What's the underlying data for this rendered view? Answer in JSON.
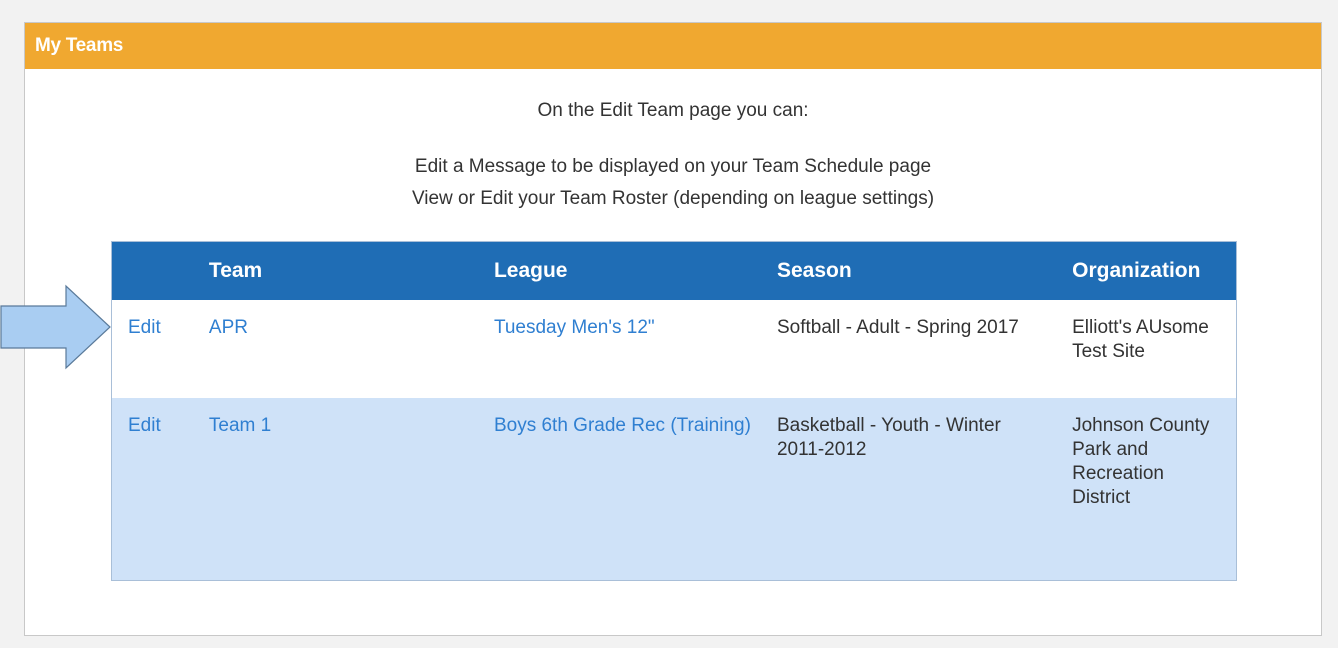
{
  "panel": {
    "title": "My Teams"
  },
  "intro": {
    "line1": "On the Edit Team page you can:",
    "line2": "Edit a Message to be displayed on your Team Schedule page",
    "line3": "View or Edit your Team Roster (depending on league settings)"
  },
  "table": {
    "headers": [
      "",
      "Team",
      "League",
      "Season",
      "Organization"
    ],
    "rows": [
      {
        "action": "Edit",
        "team": "APR",
        "league": "Tuesday Men's 12\"",
        "season": "Softball - Adult - Spring 2017",
        "organization": "Elliott's AUsome Test Site"
      },
      {
        "action": "Edit",
        "team": "Team 1",
        "league": "Boys 6th Grade Rec (Training)",
        "season": "Basketball - Youth - Winter 2011-2012",
        "organization": "Johnson County Park and Recreation District"
      }
    ]
  },
  "colors": {
    "header_orange": "#f0a830",
    "table_header_blue": "#1f6db5",
    "row_alt_blue": "#cfe2f8",
    "link_blue": "#2f7fd1",
    "arrow_fill": "#a9cdf2",
    "arrow_stroke": "#5a7a9a"
  }
}
